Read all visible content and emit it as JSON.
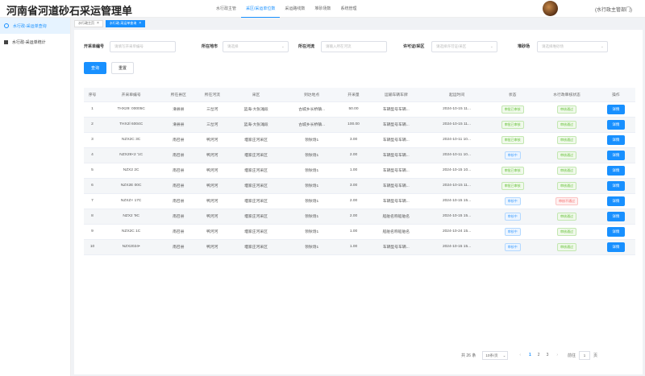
{
  "app": {
    "title": "河南省河道砂石采运管理单"
  },
  "topnav": [
    "水行政主管",
    "采区/采运单位数",
    "采运路线数",
    "堆砂场数",
    "系统管理"
  ],
  "topnav_active": 1,
  "user": {
    "name": "(水行政主管部门)"
  },
  "sidebar": {
    "items": [
      {
        "label": "水行政-采运单查询",
        "active": true
      },
      {
        "label": "水行政-采运单统计",
        "active": false
      }
    ]
  },
  "tabs": [
    {
      "label": "水行政主页",
      "close": "×"
    },
    {
      "label": "水行政-采运单查询",
      "close": "×"
    }
  ],
  "filters": {
    "bill_no": {
      "label": "开采单编号",
      "placeholder": "请填写开采单编号"
    },
    "county": {
      "label": "所在地市",
      "placeholder": "请选择"
    },
    "river": {
      "label": "所在河流",
      "placeholder": "请输入所在河流"
    },
    "permit": {
      "label": "许可证/采区",
      "placeholder": "请选择许可证/采区"
    },
    "yard": {
      "label": "堆砂场",
      "placeholder": "请选择堆砂场"
    }
  },
  "buttons": {
    "search": "查询",
    "reset": "重置"
  },
  "table": {
    "columns": [
      "序号",
      "开采单编号",
      "所在县区",
      "所在河流",
      "采区",
      "到达地点",
      "开采量",
      "运输车辆车牌",
      "起运时间",
      "状态",
      "水行政审核状态",
      "操作"
    ],
    "rows": [
      [
        "1",
        "THX29:        00005C",
        "滑县县",
        "三岔河",
        "蓝海-大张滩段",
        "古城乡长桥镇...",
        "50.00",
        "车辆型号车辆...",
        "2024-10-15 11...",
        "审批已审核",
        "审核通过",
        "详情"
      ],
      [
        "2",
        "THX2İ          6004C",
        "滑县县",
        "三岔河",
        "蓝海-大张滩段",
        "古城乡长桥镇...",
        "100.00",
        "车辆型号车辆...",
        "2024-10-15 11...",
        "审批已审核",
        "审核通过",
        "详情"
      ],
      [
        "3",
        "NZX2C            3C",
        "南召县",
        "鸭河河",
        "堰家庄河采区",
        "领秋场1",
        "3.00",
        "车辆型号车辆...",
        "2024-10-11 10...",
        "审批已审核",
        "审核通过",
        "详情"
      ],
      [
        "4",
        "NZX29×2         '1C",
        "南召县",
        "鸭河河",
        "堰家庄河采区",
        "领秋场1",
        "2.00",
        "车辆型号车辆...",
        "2024-10-11 10...",
        "审核中",
        "审核通过",
        "详情"
      ],
      [
        "5",
        "NZX2              2C",
        "南召县",
        "鸭河河",
        "堰家庄河采区",
        "领秋场1",
        "1.00",
        "车辆型号车辆...",
        "2024-10-15 10...",
        "审批已审核",
        "审核通过",
        "详情"
      ],
      [
        "6",
        "NZX2E             00C",
        "南召县",
        "鸭河河",
        "堰家庄河采区",
        "领秋场1",
        "3.00",
        "车辆型号车辆...",
        "2024-10-15 11...",
        "审批已审核",
        "审核通过",
        "详情"
      ],
      [
        "7",
        "NZXZ×            17C",
        "南召县",
        "鸭河河",
        "堰家庄河采区",
        "领秋场1",
        "2.00",
        "车辆型号车辆...",
        "2024-10-15 15...",
        "审核中",
        "审核不通过",
        "详情"
      ],
      [
        "8",
        "NZX2              '9C",
        "南召县",
        "鸭河河",
        "堰家庄河采区",
        "领秋场1",
        "2.00",
        "船舶名称船舶名",
        "2024-10-15 15...",
        "审核中",
        "审核通过",
        "详情"
      ],
      [
        "9",
        "NZX2C             1C",
        "南召县",
        "鸭河河",
        "堰家庄河采区",
        "领秋场1",
        "1.00",
        "船舶名称船舶名",
        "2024-10-24 15...",
        "审核中",
        "审核通过",
        "详情"
      ],
      [
        "10",
        "NZX2024•",
        "南召县",
        "鸭河河",
        "堰家庄河采区",
        "领秋场1",
        "1.00",
        "车辆型号车辆...",
        "2024-10-15 15...",
        "审核中",
        "审核通过",
        "详情"
      ]
    ]
  },
  "pagination": {
    "total": "共 26 条",
    "page_size": "10条/页",
    "pages": [
      "1",
      "2",
      "3"
    ],
    "current": "1",
    "goto_label": "前往",
    "goto_value": "1",
    "page_suffix": "页",
    "prev": "‹",
    "next": "›"
  },
  "colors": {
    "primary": "#1890ff",
    "success": "#67c23a",
    "danger": "#f56c6c"
  }
}
